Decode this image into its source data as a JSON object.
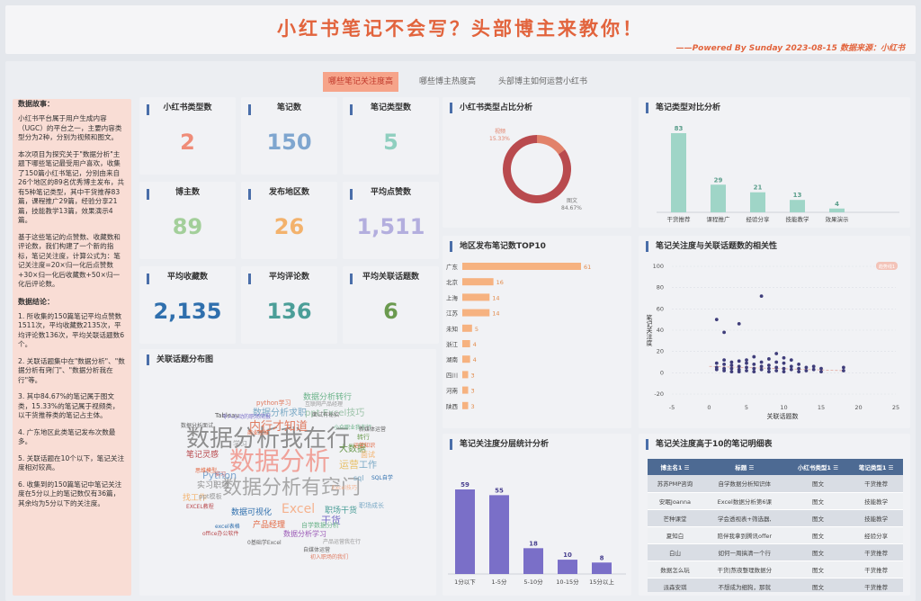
{
  "header": {
    "title": "小红书笔记不会写？头部博主来教你！",
    "subtitle": "——Powered By Sunday 2023-08-15    数据来源：小红书"
  },
  "tabs": [
    "哪些笔记关注度高",
    "哪些博主热度高",
    "头部博主如何运营小红书"
  ],
  "story": {
    "heading1": "数据故事：",
    "p1": "小红书平台属于用户生成内容（UGC）的平台之一，主要内容类型分为2种，分别为视频和图文。",
    "p2": "本次项目为探究关于\"数据分析\"主题下哪些笔记最受用户喜欢，收集了150篇小红书笔记，分别由来自26个地区的89名优秀博主发布，共有5种笔记类型，其中干货推荐83篇，课程推广29篇，经验分享21篇，技能教学13篇，效果演示4篇。",
    "p3": "基于这些笔记的点赞数、收藏数和评论数，我们构建了一个新的指标，笔记关注度，计算公式为：笔记关注度=20×归一化后点赞数+30×归一化后收藏数+50×归一化后评论数。",
    "heading2": "数据结论：",
    "c1": "1. 所收集的150篇笔记平均点赞数1511次，平均收藏数2135次，平均评论数136次，平均关联话题数6个。",
    "c2": "2. 关联话题集中在\"数据分析\"、\"数据分析有窍门\"、\"数据分析我在行\"等。",
    "c3": "3. 其中84.67%的笔记属于图文类，15.33%的笔记属于视频类，以干货推荐类的笔记占主体。",
    "c4": "4. 广东地区此类笔记发布次数最多。",
    "c5": "5. 关联话题在10个以下，笔记关注度相对较高。",
    "c6": "6. 收集到的150篇笔记中笔记关注度在5分以上的笔记数仅有36篇，其余均为5分以下的关注度。"
  },
  "kpis": [
    {
      "label": "小红书类型数",
      "value": "2",
      "color": "#ef8c78"
    },
    {
      "label": "笔记数",
      "value": "150",
      "color": "#7fa6cf"
    },
    {
      "label": "笔记类型数",
      "value": "5",
      "color": "#8fcfbf"
    },
    {
      "label": "博主数",
      "value": "89",
      "color": "#a3cf9a"
    },
    {
      "label": "发布地区数",
      "value": "26",
      "color": "#f3b26c"
    },
    {
      "label": "平均点赞数",
      "value": "1,511",
      "color": "#b3aede"
    },
    {
      "label": "平均收藏数",
      "value": "2,135",
      "color": "#2f6fad"
    },
    {
      "label": "平均评论数",
      "value": "136",
      "color": "#4b9e98"
    },
    {
      "label": "平均关联话题数",
      "value": "6",
      "color": "#6b9a4f"
    }
  ],
  "panels": {
    "pie": "小红书类型占比分析",
    "typebar": "笔记类型对比分析",
    "region": "地区发布笔记数TOP10",
    "scatter": "笔记关注度与关联话题数的相关性",
    "wordcloud": "关联话题分布图",
    "hist": "笔记关注度分层统计分析",
    "table": "笔记关注度高于10的笔记明细表"
  },
  "pie": {
    "slices": [
      {
        "name": "视频",
        "pct": "15.33%",
        "value": 15.33,
        "color": "#e2826a"
      },
      {
        "name": "图文",
        "pct": "84.67%",
        "value": 84.67,
        "color": "#b94a4e"
      }
    ]
  },
  "typebar": {
    "categories": [
      "干货推荐",
      "课程推广",
      "经验分享",
      "技能教学",
      "效果演示"
    ],
    "values": [
      83,
      29,
      21,
      13,
      4
    ],
    "color": "#9fd5c7"
  },
  "region": {
    "categories": [
      "广东",
      "北京",
      "上海",
      "江苏",
      "未知",
      "浙江",
      "湖南",
      "四川",
      "河南",
      "陕西"
    ],
    "values": [
      61,
      16,
      14,
      14,
      5,
      4,
      4,
      3,
      3,
      3
    ],
    "color": "#f6b280"
  },
  "scatter": {
    "badge": "趋势线1",
    "ylabel": "笔记关注度",
    "xlabel": "关联话题数",
    "xticks": [
      "-5",
      "0",
      "5",
      "10",
      "15",
      "20",
      "25"
    ],
    "yticks": [
      "100",
      "80",
      "60",
      "40",
      "20",
      "0",
      "-20"
    ],
    "points": [
      [
        1,
        50
      ],
      [
        2,
        38
      ],
      [
        4,
        46
      ],
      [
        7,
        72
      ],
      [
        1,
        9
      ],
      [
        1,
        5
      ],
      [
        1,
        3
      ],
      [
        2,
        12
      ],
      [
        2,
        8
      ],
      [
        2,
        4
      ],
      [
        2,
        2
      ],
      [
        3,
        10
      ],
      [
        3,
        7
      ],
      [
        3,
        4
      ],
      [
        3,
        1
      ],
      [
        4,
        11
      ],
      [
        4,
        6
      ],
      [
        4,
        3
      ],
      [
        4,
        1
      ],
      [
        5,
        12
      ],
      [
        5,
        9
      ],
      [
        5,
        5
      ],
      [
        5,
        2
      ],
      [
        6,
        15
      ],
      [
        6,
        8
      ],
      [
        6,
        4
      ],
      [
        6,
        1
      ],
      [
        7,
        10
      ],
      [
        7,
        6
      ],
      [
        7,
        3
      ],
      [
        8,
        13
      ],
      [
        8,
        7
      ],
      [
        8,
        4
      ],
      [
        8,
        1
      ],
      [
        9,
        18
      ],
      [
        9,
        10
      ],
      [
        9,
        5
      ],
      [
        9,
        2
      ],
      [
        10,
        14
      ],
      [
        10,
        9
      ],
      [
        10,
        4
      ],
      [
        10,
        1
      ],
      [
        11,
        12
      ],
      [
        11,
        6
      ],
      [
        11,
        3
      ],
      [
        12,
        8
      ],
      [
        12,
        4
      ],
      [
        12,
        1
      ],
      [
        13,
        5
      ],
      [
        13,
        2
      ],
      [
        14,
        6
      ],
      [
        14,
        3
      ],
      [
        15,
        4
      ],
      [
        15,
        1
      ],
      [
        18,
        5
      ],
      [
        18,
        2
      ]
    ],
    "color": "#3f3d7a"
  },
  "hist": {
    "categories": [
      "1分以下",
      "1-5分",
      "5-10分",
      "10-15分",
      "15分以上"
    ],
    "values": [
      59,
      55,
      18,
      10,
      8
    ],
    "color": "#7a6fc8"
  },
  "table": {
    "headers": [
      "博主名1",
      "标题",
      "小红书类型1",
      "笔记类型1"
    ],
    "rows": [
      [
        "苏苏PMP咨询",
        "自学数据分析知识体",
        "图文",
        "干货推荐"
      ],
      [
        "安眠Joanna",
        "Excel数据分析第6课",
        "图文",
        "技能教学"
      ],
      [
        "芒种课堂",
        "学会透视表+筛选器,",
        "图文",
        "技能教学"
      ],
      [
        "夏知白",
        "陪伴我拿到腾讯offer",
        "图文",
        "经验分享"
      ],
      [
        "白山",
        "如何一周搞清一个行",
        "图文",
        "干货推荐"
      ],
      [
        "数据怎么玩",
        "干货|熬夜整理数据分",
        "图文",
        "干货推荐"
      ],
      [
        "派森安琪",
        "不想成为细狗，那就",
        "图文",
        "干货推荐"
      ]
    ]
  },
  "wordcloud": [
    {
      "t": "数据分析我在行",
      "c": "#8e8e8e",
      "s": 26
    },
    {
      "t": "数据分析",
      "c": "#f0a29a",
      "s": 28
    },
    {
      "t": "数据分析有窍门",
      "c": "#a7a7a7",
      "s": 22
    },
    {
      "t": "内行才知道",
      "c": "#e07a5f",
      "s": 13
    },
    {
      "t": "数据分析求职",
      "c": "#7aa9c5",
      "s": 10
    },
    {
      "t": "ppt Excel技巧",
      "c": "#9cc3a9",
      "s": 10
    },
    {
      "t": "数据分析转行",
      "c": "#6bb38a",
      "s": 9
    },
    {
      "t": "Python",
      "c": "#7fa6cf",
      "s": 11
    },
    {
      "t": "Excel",
      "c": "#f5b28e",
      "s": 14
    },
    {
      "t": "干货",
      "c": "#7a6fc8",
      "s": 11
    },
    {
      "t": "职场干货",
      "c": "#4b9e98",
      "s": 9
    },
    {
      "t": "运营",
      "c": "#e8c16a",
      "s": 11
    },
    {
      "t": "工作",
      "c": "#7aa9c5",
      "s": 10
    },
    {
      "t": "大数据",
      "c": "#6b9a4f",
      "s": 10
    },
    {
      "t": "实习职场",
      "c": "#8e8e8e",
      "s": 9
    },
    {
      "t": "笔记灵感",
      "c": "#b94a4e",
      "s": 9
    },
    {
      "t": "数据可视化",
      "c": "#2f6fad",
      "s": 9
    },
    {
      "t": "产品经理",
      "c": "#e2643d",
      "s": 9
    },
    {
      "t": "数据分析学习",
      "c": "#9b59b6",
      "s": 8
    },
    {
      "t": "python学习",
      "c": "#e07a5f",
      "s": 7
    },
    {
      "t": "面试",
      "c": "#f3b26c",
      "s": 8
    },
    {
      "t": "找工作",
      "c": "#f3b26c",
      "s": 9
    },
    {
      "t": "sql",
      "c": "#7aa9c5",
      "s": 8
    },
    {
      "t": "自学数据分析",
      "c": "#6bb38a",
      "s": 7
    },
    {
      "t": "Tableau",
      "c": "#555555",
      "s": 7
    },
    {
      "t": "令人心动的职场简报",
      "c": "#7a6fc8",
      "s": 6
    },
    {
      "t": "互联网产品经理",
      "c": "#999999",
      "s": 6
    },
    {
      "t": "面试有秘招",
      "c": "#666666",
      "s": 6
    },
    {
      "t": "小众职业我在行",
      "c": "#6bb38a",
      "s": 6
    },
    {
      "t": "数据分析面试",
      "c": "#666666",
      "s": 6
    },
    {
      "t": "商业思维",
      "c": "#e2643d",
      "s": 6
    },
    {
      "t": "转行",
      "c": "#6b9a4f",
      "s": 7
    },
    {
      "t": "Excel技巧",
      "c": "#f5b28e",
      "s": 6
    },
    {
      "t": "SQL自学",
      "c": "#2f6fad",
      "s": 6
    },
    {
      "t": "实习",
      "c": "#b94a4e",
      "s": 6
    },
    {
      "t": "学习",
      "c": "#999999",
      "s": 8
    },
    {
      "t": "excel表格",
      "c": "#2f6fad",
      "s": 6
    },
    {
      "t": "运营知识",
      "c": "#e2643d",
      "s": 6
    },
    {
      "t": "0基础学Excel",
      "c": "#666666",
      "s": 6
    },
    {
      "t": "产品运营我在行",
      "c": "#999999",
      "s": 6
    },
    {
      "t": "自媒体运营",
      "c": "#666666",
      "s": 6
    },
    {
      "t": "初入职场的我们",
      "c": "#e07a5f",
      "s": 6
    },
    {
      "t": "职场成长",
      "c": "#7aa9c5",
      "s": 7
    },
    {
      "t": "ppt模板",
      "c": "#999999",
      "s": 7
    },
    {
      "t": "新媒体运营",
      "c": "#666666",
      "s": 6
    },
    {
      "t": "office办公软件",
      "c": "#b94a4e",
      "s": 6
    },
    {
      "t": "EXCEL教程",
      "c": "#b94a4e",
      "s": 6
    },
    {
      "t": "思维模型",
      "c": "#e2643d",
      "s": 6
    }
  ]
}
